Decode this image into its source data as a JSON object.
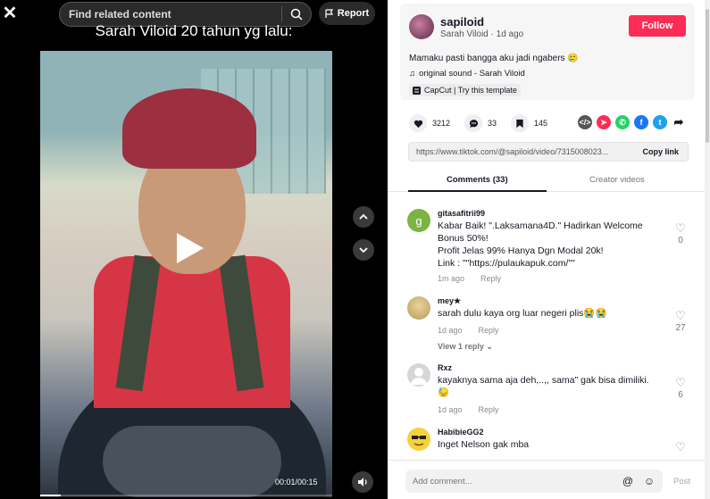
{
  "topbar": {
    "search_placeholder": "Find related content",
    "report_label": "Report"
  },
  "video": {
    "caption": "Sarah Viloid 20 tahun yg lalu:",
    "time": "00:01/00:15",
    "progress_fraction": 0.07
  },
  "author": {
    "username": "sapiloid",
    "display_line": "Sarah Viloid · 1d ago",
    "follow_label": "Follow",
    "description": "Mamaku pasti bangga aku jadi ngabers 🥲",
    "sound": "original sound - Sarah Viloid",
    "capcut": "CapCut | Try this template"
  },
  "stats": {
    "likes": "3212",
    "comments": "33",
    "saves": "145"
  },
  "share": {
    "link": "https://www.tiktok.com/@sapiloid/video/7315008023...",
    "copy_label": "Copy link"
  },
  "tabs": {
    "comments": "Comments (33)",
    "creator": "Creator videos"
  },
  "comments": [
    {
      "name": "gitasafitrii99",
      "avatar_letter": "g",
      "avatar_color": "#7cb342",
      "lines": [
        "Kabar Baik! \".Laksamana4D.\" Hadirkan Welcome",
        "Bonus 50%!",
        "Profit Jelas 99% Hanya Dgn Modal 20k!",
        "Link : \"\"https://pulaukapuk.com/\"\""
      ],
      "time": "1m ago",
      "reply": "Reply",
      "likes": "0"
    },
    {
      "name": "mey★",
      "lines": [
        "sarah dulu kaya org luar negeri plis😭😭"
      ],
      "time": "1d ago",
      "reply": "Reply",
      "likes": "27",
      "view_replies": "View 1 reply ⌄"
    },
    {
      "name": "Rxz",
      "lines": [
        "kayaknya sama aja deh,..,, sama\" gak bisa dimiliki.",
        "😓"
      ],
      "time": "1d ago",
      "reply": "Reply",
      "likes": "6"
    },
    {
      "name": "HabibieGG2",
      "lines": [
        "Inget Nelson gak mba"
      ]
    }
  ],
  "composer": {
    "placeholder": "Add comment...",
    "post_label": "Post"
  }
}
